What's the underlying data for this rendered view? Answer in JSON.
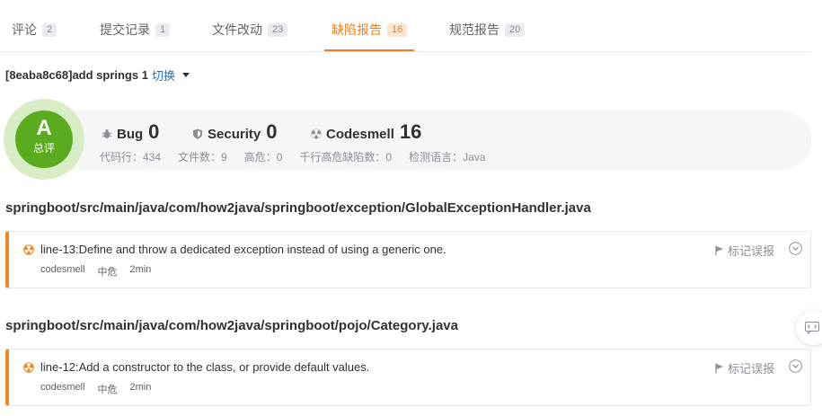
{
  "tabs": [
    {
      "label": "评论",
      "count": "2"
    },
    {
      "label": "提交记录",
      "count": "1"
    },
    {
      "label": "文件改动",
      "count": "23"
    },
    {
      "label": "缺陷报告",
      "count": "16"
    },
    {
      "label": "规范报告",
      "count": "20"
    }
  ],
  "commit": {
    "title": "[8eaba8c68]add springs 1",
    "switch_label": "切换"
  },
  "grade": {
    "letter": "A",
    "label": "总评"
  },
  "metrics": [
    {
      "name": "Bug",
      "value": "0",
      "icon": "bug-icon"
    },
    {
      "name": "Security",
      "value": "0",
      "icon": "shield-icon"
    },
    {
      "name": "Codesmell",
      "value": "16",
      "icon": "radiation-icon"
    }
  ],
  "stats": [
    "代码行：434",
    "文件数：9",
    "高危：0",
    "千行高危缺陷数：0",
    "检测语言：Java"
  ],
  "files": [
    {
      "path": "springboot/src/main/java/com/how2java/springboot/exception/GlobalExceptionHandler.java",
      "issues": [
        {
          "message": "line-13:Define and throw a dedicated exception instead of using a generic one.",
          "type": "codesmell",
          "severity": "中危",
          "effort": "2min",
          "report_label": "标记误报"
        }
      ]
    },
    {
      "path": "springboot/src/main/java/com/how2java/springboot/pojo/Category.java",
      "issues": [
        {
          "message": "line-12:Add a constructor to the class, or provide default values.",
          "type": "codesmell",
          "severity": "中危",
          "effort": "2min",
          "report_label": "标记误报"
        }
      ]
    }
  ],
  "colors": {
    "accent": "#f07f1f",
    "grade": "#5bab21",
    "issue_border": "#f5871f",
    "link": "#1f6fd1"
  }
}
